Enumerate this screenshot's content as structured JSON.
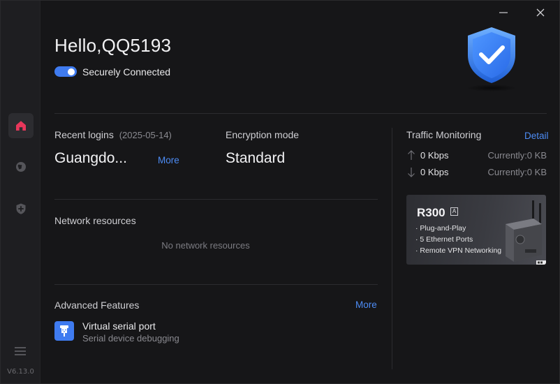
{
  "app": {
    "version": "V6.13.0",
    "accent": "#3f7bf0",
    "link_color": "#4d8cf5",
    "home_active_color": "#e8375b"
  },
  "sidebar": {
    "items": [
      {
        "icon": "home-icon",
        "active": true
      },
      {
        "icon": "globe-icon",
        "active": false
      },
      {
        "icon": "shield-plus-icon",
        "active": false
      }
    ],
    "menu_icon": "hamburger-menu-icon"
  },
  "header": {
    "greeting": "Hello,QQ5193",
    "connection_status": "Securely Connected",
    "connected": true,
    "shield_icon": "shield-check-icon"
  },
  "recent_logins": {
    "label": "Recent logins",
    "date": "(2025-05-14)",
    "location": "Guangdo...",
    "more_label": "More"
  },
  "encryption": {
    "label": "Encryption mode",
    "value": "Standard"
  },
  "network_resources": {
    "label": "Network resources",
    "empty_text": "No network resources"
  },
  "advanced_features": {
    "label": "Advanced Features",
    "more_label": "More",
    "items": [
      {
        "icon": "serial-port-icon",
        "title": "Virtual serial port",
        "description": "Serial device debugging"
      }
    ]
  },
  "traffic": {
    "label": "Traffic Monitoring",
    "detail_label": "Detail",
    "upload": {
      "rate": "0 Kbps",
      "current": "Currently:0 KB"
    },
    "download": {
      "rate": "0 Kbps",
      "current": "Currently:0 KB"
    }
  },
  "banner": {
    "title": "R300",
    "badge": "A",
    "items": [
      "Plug-and-Play",
      "5 Ethernet Ports",
      "Remote VPN Networking"
    ]
  }
}
